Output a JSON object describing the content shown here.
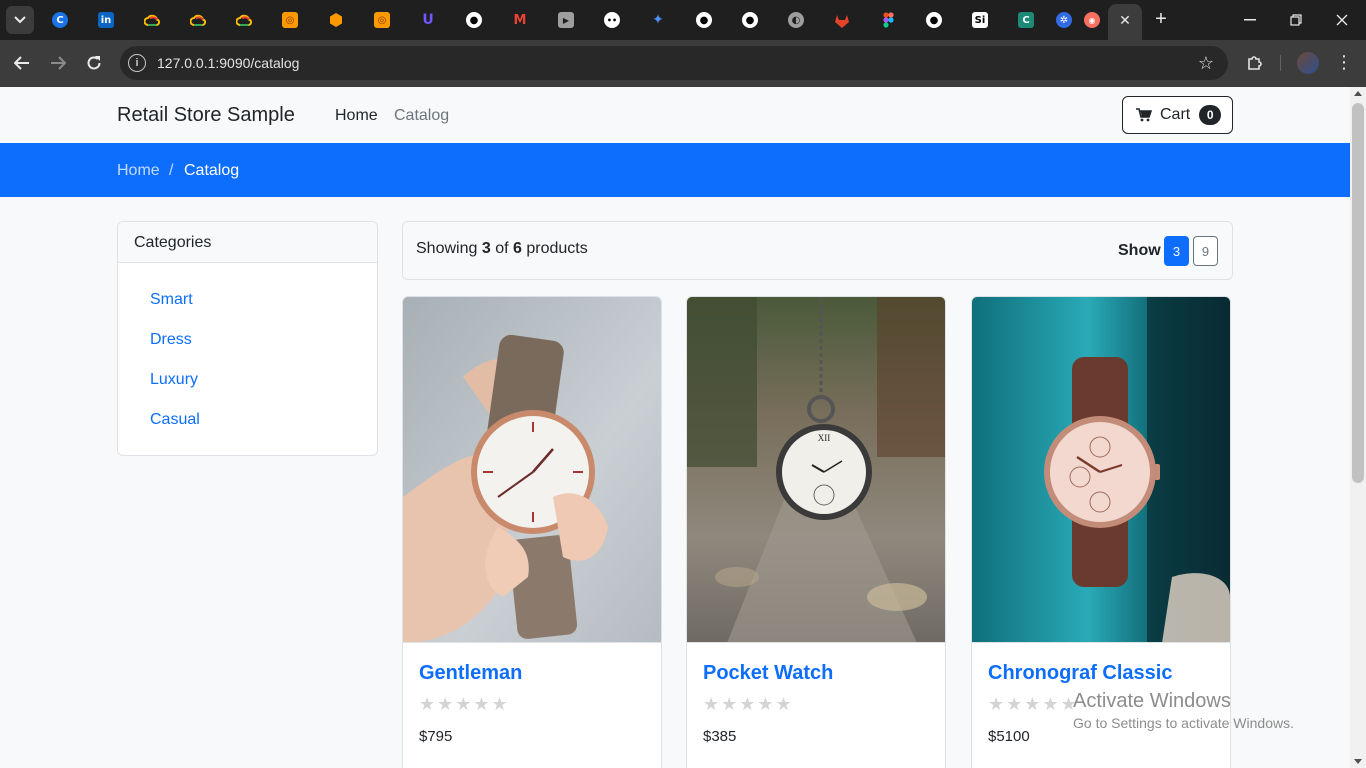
{
  "browser": {
    "url": "127.0.0.1:9090/catalog",
    "tab_favicons": [
      "c-icon",
      "linkedin-icon",
      "google-cloud-icon",
      "google-cloud-icon",
      "google-cloud-icon",
      "orange-square-icon",
      "orange-hex-icon",
      "orange-square-icon",
      "purple-u-icon",
      "github-icon",
      "gmail-icon",
      "youtube-icon",
      "chat-bot-icon",
      "gemini-icon",
      "github-icon",
      "github-icon",
      "globe-icon",
      "gitlab-icon",
      "figma-icon",
      "github-icon",
      "si-icon",
      "c-green-icon",
      "kubernetes-icon",
      "red-circle-icon"
    ]
  },
  "navbar": {
    "brand": "Retail Store Sample",
    "links": [
      {
        "label": "Home"
      },
      {
        "label": "Catalog"
      }
    ],
    "cart_label": "Cart",
    "cart_count": "0"
  },
  "breadcrumb": {
    "home": "Home",
    "separator": "/",
    "current": "Catalog"
  },
  "categories": {
    "title": "Categories",
    "items": [
      "Smart",
      "Dress",
      "Luxury",
      "Casual"
    ]
  },
  "listing": {
    "showing_prefix": "Showing",
    "shown": "3",
    "of_word": "of",
    "total": "6",
    "suffix": "products",
    "show_label": "Show",
    "page_sizes": [
      "3",
      "9"
    ],
    "selected_page_size": "3"
  },
  "products": [
    {
      "name": "Gentleman",
      "stars": "★★★★★",
      "rating": 0,
      "price": "$795"
    },
    {
      "name": "Pocket Watch",
      "stars": "★★★★★",
      "rating": 0,
      "price": "$385"
    },
    {
      "name": "Chronograf Classic",
      "stars": "★★★★★",
      "rating": 0,
      "price": "$5100"
    }
  ],
  "watermark": {
    "line1": "Activate Windows",
    "line2": "Go to Settings to activate Windows."
  },
  "colors": {
    "primary": "#0d6efd",
    "dark": "#212529",
    "muted": "#6c757d"
  }
}
